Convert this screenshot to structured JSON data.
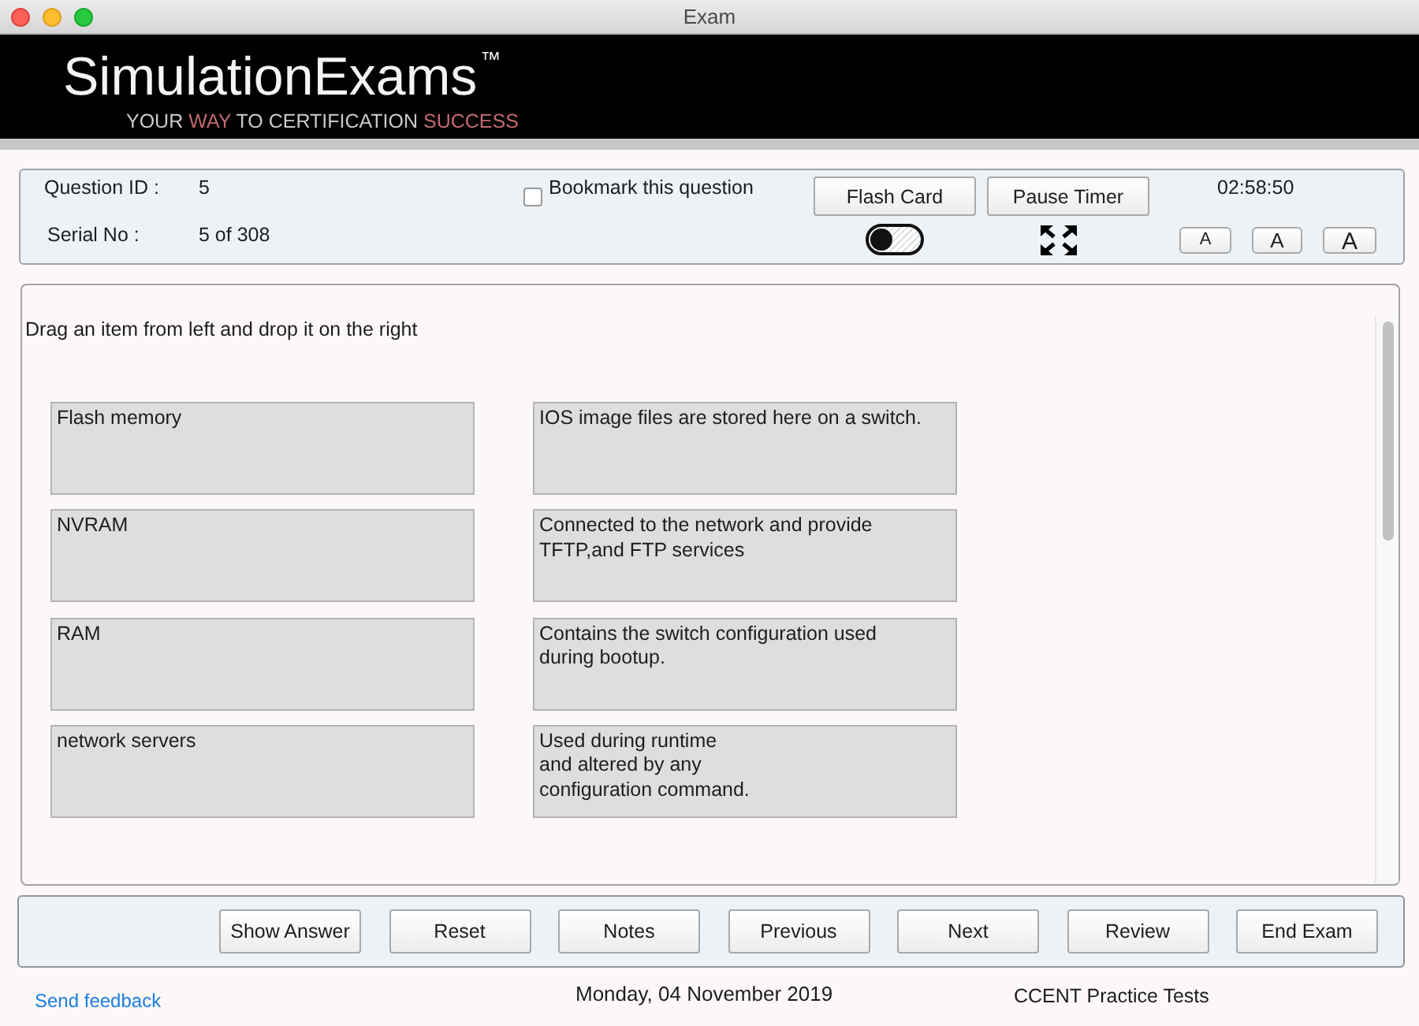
{
  "window": {
    "title": "Exam"
  },
  "banner": {
    "logo": "SimulationExams$^{™}$",
    "tagline": [
      {
        "text": "YOUR",
        "highlight": false
      },
      {
        "text": "WAY",
        "highlight": true
      },
      {
        "text": "TO CERTIFICATION",
        "highlight": false
      },
      {
        "text": "SUCCESS",
        "highlight": true
      }
    ]
  },
  "header": {
    "question_id": {
      "label": "Question ID :",
      "value": "5"
    },
    "serial_no": {
      "label": "Serial No :",
      "value": "5 of 308"
    },
    "bookmark": {
      "label": "Bookmark this question",
      "checked": false
    },
    "flash_card_button": "Flash Card",
    "pause_timer_button": "Pause Timer",
    "timer": "02:58:50",
    "toggle": {
      "on": false
    },
    "font_size_buttons": [
      "A",
      "A",
      "A"
    ]
  },
  "question": {
    "instruction": "Drag an item from left and drop it on the right",
    "items": [
      "Flash memory",
      "NVRAM",
      "RAM",
      "network servers"
    ],
    "targets": [
      "IOS image files are stored here on a switch.",
      "Connected to the network and provide\nTFTP,and FTP services",
      "Contains the switch configuration used\nduring bootup.",
      "Used during runtime\nand altered by any\nconfiguration command."
    ]
  },
  "footer_buttons": [
    "Show Answer",
    "Reset",
    "Notes",
    "Previous",
    "Next",
    "Review",
    "End Exam"
  ],
  "status_bar": {
    "feedback_link": "Send feedback",
    "date": "Monday, 04 November 2019",
    "product": "CCENT Practice Tests"
  }
}
